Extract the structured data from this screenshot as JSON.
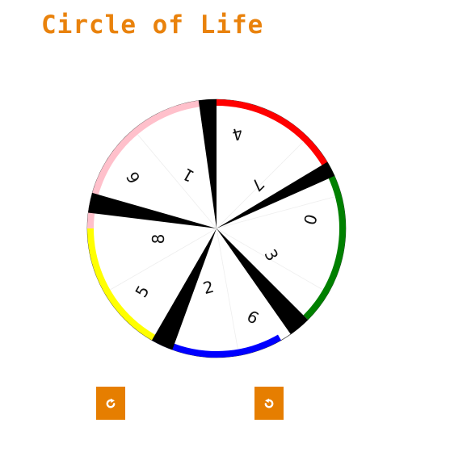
{
  "title": "Circle of Life",
  "wheel": {
    "slices": [
      {
        "number": "4",
        "rotation": 165
      },
      {
        "number": "7",
        "rotation": 135
      },
      {
        "number": "0",
        "rotation": 105
      },
      {
        "number": "3",
        "rotation": 60
      },
      {
        "number": "6",
        "rotation": 30
      },
      {
        "number": "2",
        "rotation": -15
      },
      {
        "number": "5",
        "rotation": -60
      },
      {
        "number": "8",
        "rotation": -90
      },
      {
        "number": "6",
        "rotation": -120
      },
      {
        "number": "1",
        "rotation": -150
      }
    ],
    "rim_arcs": [
      {
        "color": "#ff0000",
        "from": 0,
        "to": 60
      },
      {
        "color": "#008000",
        "from": 60,
        "to": 135
      },
      {
        "color": "#0000ff",
        "from": 150,
        "to": 210
      },
      {
        "color": "#ffff00",
        "from": 210,
        "to": 270
      },
      {
        "color": "#ffc0cb",
        "from": 270,
        "to": 352
      }
    ],
    "wedges": [
      {
        "from": 352,
        "to": 360
      },
      {
        "from": 59,
        "to": 66
      },
      {
        "from": 135,
        "to": 145
      },
      {
        "from": 200,
        "to": 210
      },
      {
        "from": 277,
        "to": 286
      }
    ]
  },
  "controls": {
    "rotate_cw": {
      "icon": "rotate-clockwise-icon"
    },
    "rotate_ccw": {
      "icon": "rotate-counterclockwise-icon"
    }
  },
  "colors": {
    "accent": "#e67e00",
    "title": "#e9820c"
  }
}
